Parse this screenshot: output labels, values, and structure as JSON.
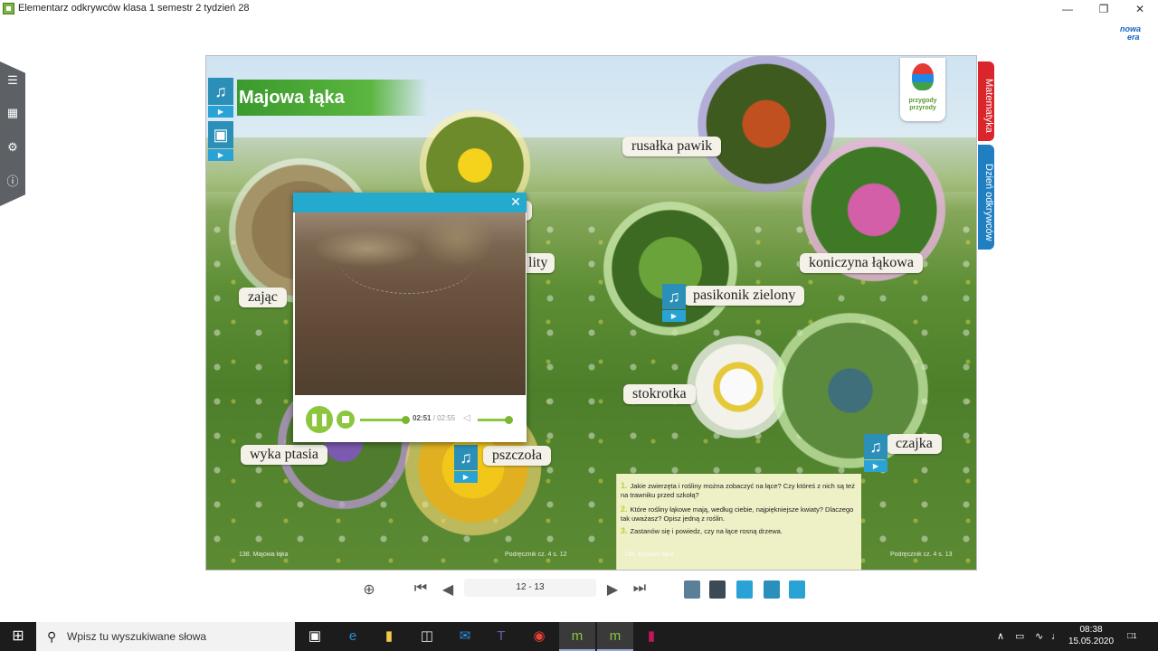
{
  "window": {
    "title": "Elementarz odkrywców klasa 1 semestr 2 tydzień 28",
    "minimize": "—",
    "maximize": "❐",
    "close": "✕"
  },
  "publisher_logo": {
    "line1": "nowa",
    "line2": "era"
  },
  "sidebar": {
    "icons": [
      "table-of-contents-icon",
      "zoom-page-icon",
      "gear-icon",
      "info-icon"
    ]
  },
  "page": {
    "title": "Majowa łąka",
    "sticker": "przygody przyrody",
    "side_tabs": [
      "Matematyka",
      "Dzień odkrywców"
    ],
    "labels": {
      "rusalka": "rusałka pawik",
      "koniczyna": "koniczyna łąkowa",
      "pasikonik": "pasikonik zielony",
      "stokrotka": "stokrotka",
      "czajka": "czajka",
      "zajac": "zając",
      "wyka": "wyka ptasia",
      "pszczola": "pszczoła",
      "partial_1": "y",
      "partial_2": "lity"
    },
    "questions": [
      {
        "num": "1.",
        "text": "Jakie zwierzęta i rośliny można zobaczyć na łące? Czy któreś z nich są też na trawniku przed szkołą?"
      },
      {
        "num": "2.",
        "text": "Które rośliny łąkowe mają, według ciebie, najpiękniejsze kwiaty? Dlaczego tak uważasz? Opisz jedną z roślin."
      },
      {
        "num": "3.",
        "text": "Zastanów się i powiedz, czy na łące rosną drzewa."
      }
    ],
    "footers": {
      "left": "138. Majowa łąka",
      "mid": "Podręcznik cz. 4 s. 12",
      "mid2": "138. Majowa łąka",
      "right": "Podręcznik cz. 4 s. 13"
    }
  },
  "video_player": {
    "current_time": "02:51",
    "separator": "/",
    "total_time": "02:55",
    "progress": 0.977,
    "volume": 0.9
  },
  "navbar": {
    "page_range": "12 - 13"
  },
  "taskbar": {
    "search_placeholder": "Wpisz tu wyszukiwane słowa",
    "time": "08:38",
    "date": "15.05.2020",
    "notifications": "1"
  },
  "colors": {
    "accent_green": "#8cc63f",
    "popup_header": "#23aacd",
    "title_green": "#3b9a2e",
    "tab_red": "#d9252b",
    "tab_blue": "#1f7fc1"
  }
}
